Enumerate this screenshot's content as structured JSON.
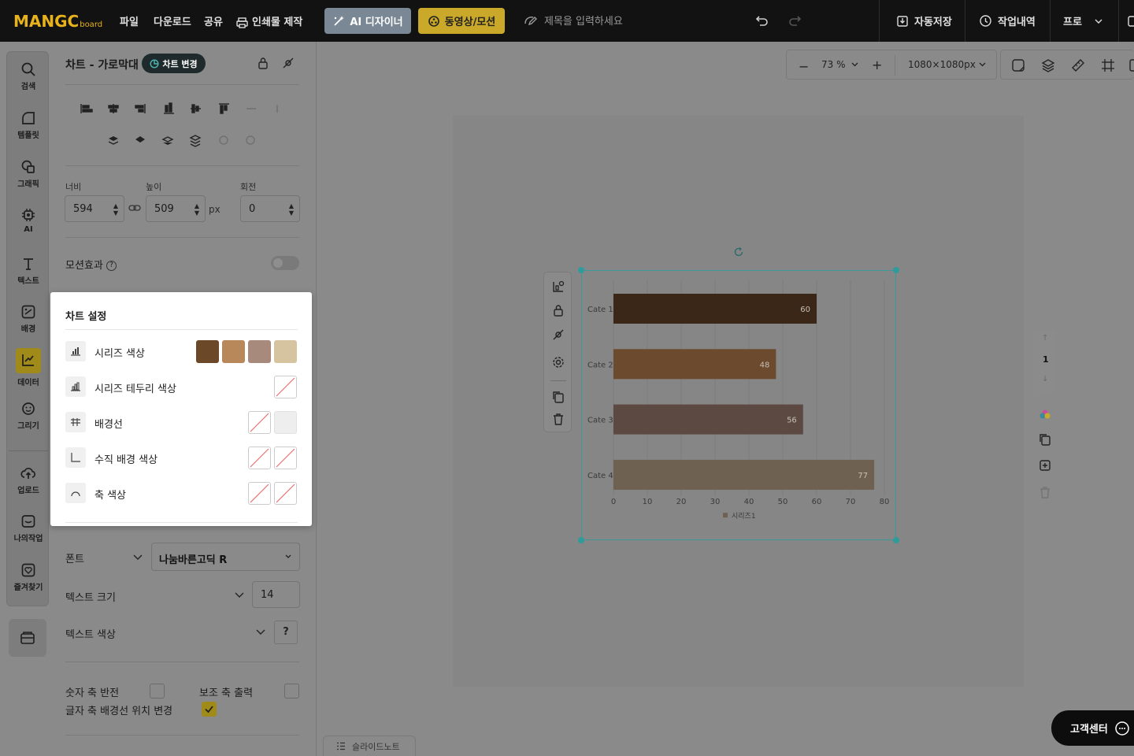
{
  "topbar": {
    "logo_main": "MANGC",
    "logo_sub": "board",
    "menu": [
      "파일",
      "다운로드",
      "공유",
      "인쇄물 제작"
    ],
    "ai_button": "AI 디자이너",
    "video_button": "동영상/모션",
    "title_placeholder": "제목을 입력하세요",
    "autosave": "자동저장",
    "history": "작업내역",
    "pro": "프로"
  },
  "rail": {
    "items": [
      "검색",
      "템플릿",
      "그래픽",
      "AI",
      "텍스트",
      "배경",
      "데이터",
      "그리기",
      "업로드",
      "나의작업",
      "즐겨찾기"
    ]
  },
  "panel": {
    "title": "차트 - 가로막대",
    "change_chart": "차트 변경",
    "width_label": "너비",
    "height_label": "높이",
    "rotation_label": "회전",
    "width_value": "594",
    "height_value": "509",
    "unit": "px",
    "rotation_value": "0",
    "motion_label": "모션효과",
    "font_label": "폰트",
    "font_value": "나눔바른고딕 R",
    "text_size_label": "텍스트 크기",
    "text_size_value": "14",
    "text_color_label": "텍스트 색상",
    "text_color_value": "?",
    "reverse_axis": "숫자 축 반전",
    "secondary_axis": "보조 축 출력",
    "category_grid": "글자 축 배경선 위치 변경"
  },
  "popup": {
    "title": "차트 설정",
    "rows": [
      "시리즈 색상",
      "시리즈 테두리 색상",
      "배경선",
      "수직 배경 색상",
      "축 색상"
    ],
    "series_colors": [
      "#6b4828",
      "#b8875a",
      "#a88a7c",
      "#d6c3a0"
    ],
    "grid_color": "#eeeeee"
  },
  "canvas": {
    "zoom": "73 %",
    "size": "1080×1080px",
    "page_number": "1"
  },
  "chart_data": {
    "type": "bar",
    "orientation": "horizontal",
    "categories": [
      "Cate 1",
      "Cate 2",
      "Cate 3",
      "Cate 4"
    ],
    "series": [
      {
        "name": "시리즈1",
        "values": [
          60,
          48,
          56,
          77
        ]
      }
    ],
    "bar_colors": [
      "#3b2718",
      "#6b4a2e",
      "#5c4a42",
      "#6e6152"
    ],
    "xlim": [
      0,
      80
    ],
    "xticks": [
      "0",
      "10",
      "20",
      "30",
      "40",
      "50",
      "60",
      "70",
      "80"
    ],
    "legend": "bottom",
    "grid": true
  },
  "footer": {
    "slide_note": "슬라이드노트",
    "support": "고객센터"
  }
}
